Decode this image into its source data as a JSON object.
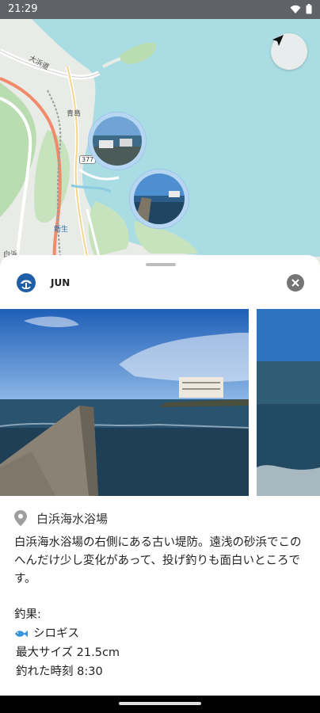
{
  "status_bar": {
    "time": "21:29"
  },
  "map": {
    "labels": {
      "shirahama_area": "白浜",
      "shinsei": "新生",
      "aoshima": "青島",
      "kanji_road": "大浜道"
    },
    "route_number": "377"
  },
  "post": {
    "user_name": "JUN",
    "spot_name": "白浜海水浴場",
    "description": "白浜海水浴場の右側にある古い堤防。遠浅の砂浜でこのへんだけ少し変化があって、投げ釣りも面白いところです。",
    "catch_header": "釣果:",
    "fish_name": "シロギス",
    "max_size": "最大サイズ 21.5cm",
    "catch_time": "釣れた時刻 8:30"
  },
  "colors": {
    "accent_blue": "#1e5fa8",
    "map_water": "#aadde3",
    "map_land": "#e8ebe6"
  },
  "icons": [
    "navigation-arrow-icon",
    "location-pin-icon",
    "close-icon",
    "fish-icon",
    "wifi-icon",
    "battery-icon"
  ]
}
